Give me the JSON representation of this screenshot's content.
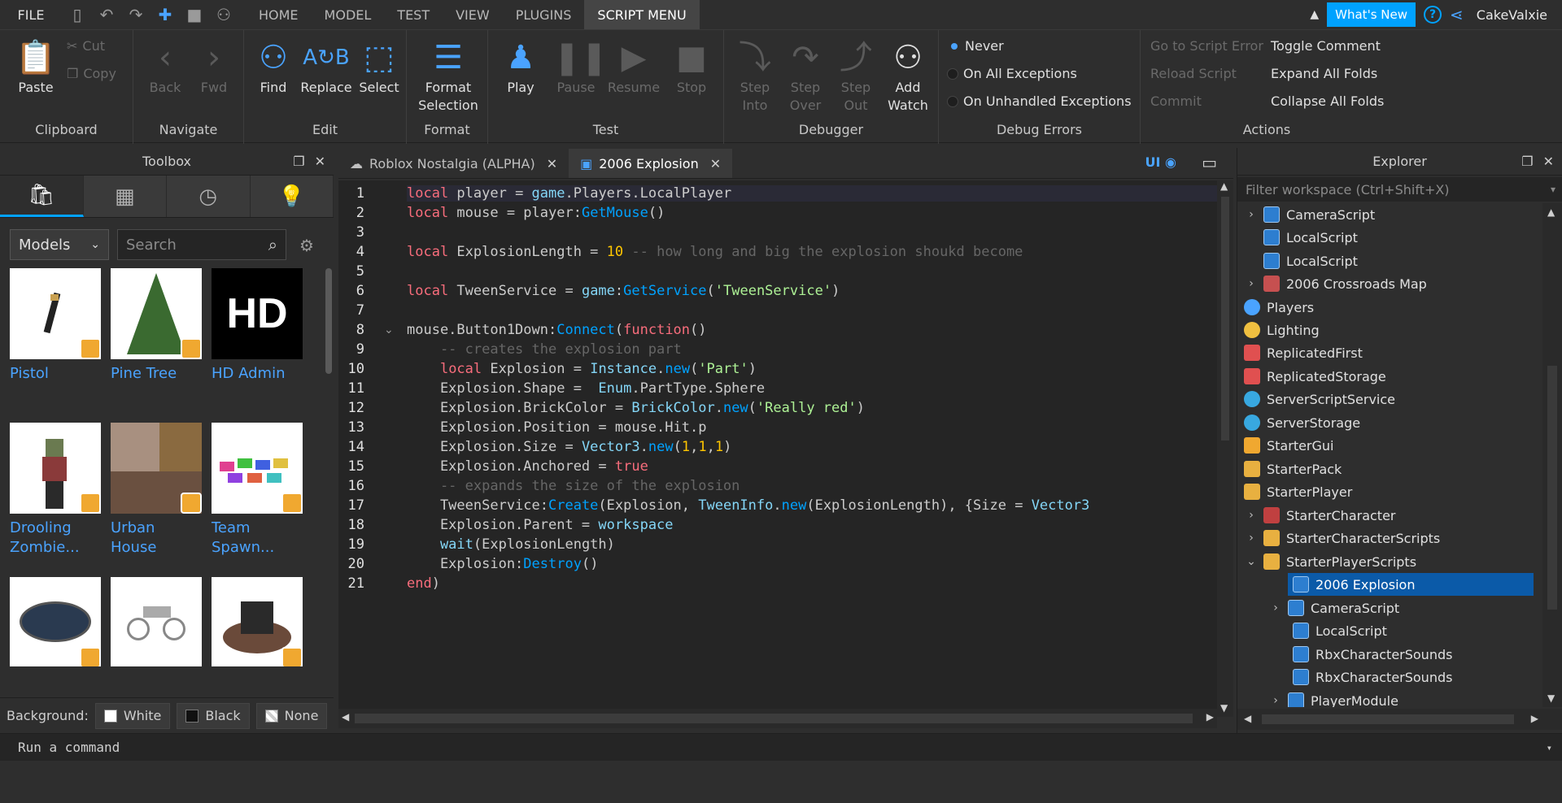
{
  "menubar": {
    "file": "FILE",
    "tabs": [
      "HOME",
      "MODEL",
      "TEST",
      "VIEW",
      "PLUGINS",
      "SCRIPT MENU"
    ],
    "active_tab": "SCRIPT MENU",
    "whats_new": "What's New",
    "help": "?",
    "username": "CakeValxie"
  },
  "ribbon": {
    "clipboard": {
      "title": "Clipboard",
      "paste": "Paste",
      "cut": "Cut",
      "copy": "Copy"
    },
    "navigate": {
      "title": "Navigate",
      "back": "Back",
      "fwd": "Fwd"
    },
    "edit": {
      "title": "Edit",
      "find": "Find",
      "replace": "Replace",
      "select": "Select"
    },
    "format": {
      "title": "Format",
      "format_line1": "Format",
      "format_line2": "Selection"
    },
    "test": {
      "title": "Test",
      "play": "Play",
      "pause": "Pause",
      "resume": "Resume",
      "stop": "Stop"
    },
    "debugger": {
      "title": "Debugger",
      "step_into_1": "Step",
      "step_into_2": "Into",
      "step_over_1": "Step",
      "step_over_2": "Over",
      "step_out_1": "Step",
      "step_out_2": "Out",
      "add_watch_1": "Add",
      "add_watch_2": "Watch"
    },
    "debug_errors": {
      "title": "Debug Errors",
      "never": "Never",
      "on_all": "On All Exceptions",
      "on_unhandled": "On Unhandled Exceptions"
    },
    "actions": {
      "title": "Actions",
      "goto_error": "Go to Script Error",
      "reload": "Reload Script",
      "commit": "Commit",
      "toggle_comment": "Toggle Comment",
      "expand": "Expand All Folds",
      "collapse": "Collapse All Folds"
    }
  },
  "toolbox": {
    "title": "Toolbox",
    "category": "Models",
    "search_placeholder": "Search",
    "items": [
      {
        "label": "Pistol"
      },
      {
        "label": "Pine Tree"
      },
      {
        "label": "HD Admin",
        "thumb_text": "HD"
      },
      {
        "label": "Drooling Zombie..."
      },
      {
        "label": "Urban House"
      },
      {
        "label": "Team Spawn..."
      },
      {
        "label": ""
      },
      {
        "label": ""
      },
      {
        "label": ""
      }
    ],
    "background_label": "Background:",
    "bg_white": "White",
    "bg_black": "Black",
    "bg_none": "None"
  },
  "editor": {
    "tab1": "Roblox Nostalgia (ALPHA)",
    "tab2": "2006 Explosion",
    "ui_label": "UI",
    "line_numbers": [
      "1",
      "2",
      "3",
      "4",
      "5",
      "6",
      "7",
      "8",
      "9",
      "10",
      "11",
      "12",
      "13",
      "14",
      "15",
      "16",
      "17",
      "18",
      "19",
      "20",
      "21"
    ]
  },
  "explorer": {
    "title": "Explorer",
    "filter_placeholder": "Filter workspace (Ctrl+Shift+X)",
    "nodes": [
      "CameraScript",
      "LocalScript",
      "LocalScript",
      "2006 Crossroads Map",
      "Players",
      "Lighting",
      "ReplicatedFirst",
      "ReplicatedStorage",
      "ServerScriptService",
      "ServerStorage",
      "StarterGui",
      "StarterPack",
      "StarterPlayer",
      "StarterCharacter",
      "StarterCharacterScripts",
      "StarterPlayerScripts",
      "2006 Explosion",
      "CameraScript",
      "LocalScript",
      "RbxCharacterSounds",
      "RbxCharacterSounds",
      "PlayerModule"
    ]
  },
  "command": {
    "placeholder": "Run a command"
  }
}
